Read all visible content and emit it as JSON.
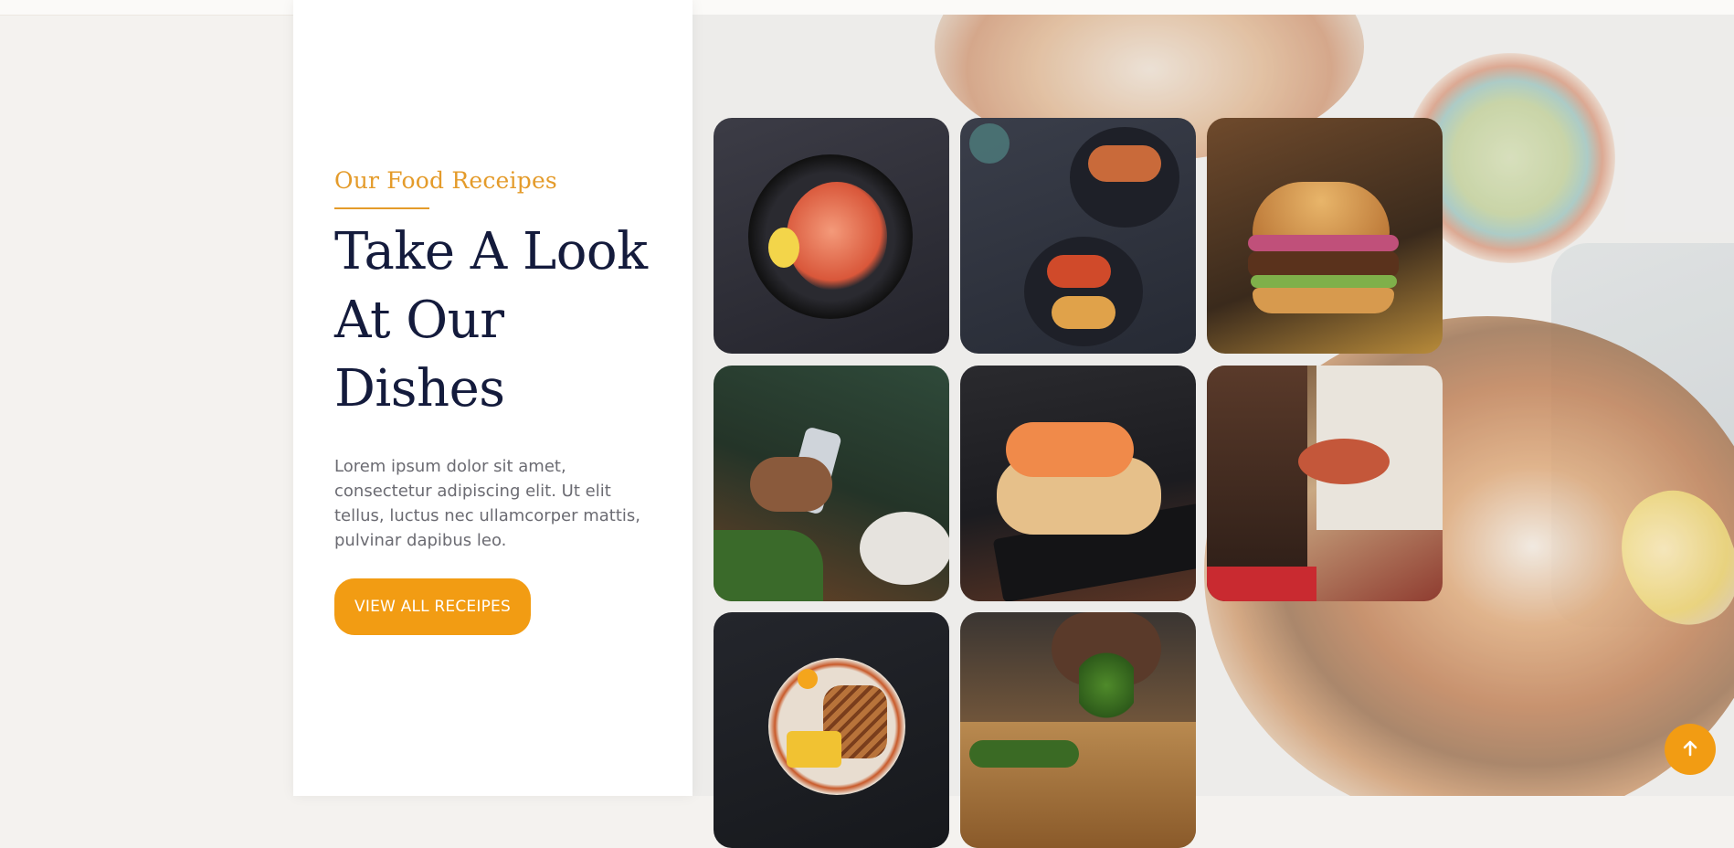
{
  "section": {
    "eyebrow": "Our Food Receipes",
    "headline": "Take A Look At Our Dishes",
    "description": "Lorem ipsum dolor sit amet, consectetur adipiscing elit. Ut elit tellus, luctus nec ullamcorper mattis, pulvinar dapibus leo.",
    "cta_label": "VIEW ALL RECEIPES"
  },
  "gallery": {
    "images": [
      {
        "name": "shrimp-pan-image"
      },
      {
        "name": "bruschetta-image"
      },
      {
        "name": "burger-image"
      },
      {
        "name": "phone-dining-image"
      },
      {
        "name": "salmon-toast-image"
      },
      {
        "name": "chef-serving-image"
      },
      {
        "name": "sandwich-fries-image"
      },
      {
        "name": "herbs-garnish-image"
      }
    ]
  },
  "scroll_top": {
    "icon": "arrow-up-icon"
  },
  "colors": {
    "accent": "#f29c13",
    "eyebrow": "#e49b2a",
    "headline": "#141b3c",
    "body_text": "#6b6b72",
    "panel_bg": "#ffffff",
    "page_bg": "#f4f2ef"
  }
}
